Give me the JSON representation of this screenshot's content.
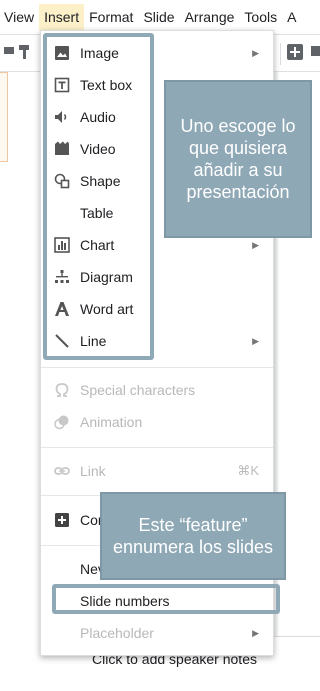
{
  "menubar": {
    "items": [
      "View",
      "Insert",
      "Format",
      "Slide",
      "Arrange",
      "Tools",
      "A"
    ],
    "active": "Insert"
  },
  "insert_menu": {
    "items": [
      {
        "label": "Image",
        "icon": "image-icon",
        "submenu": true
      },
      {
        "label": "Text box",
        "icon": "text-box-icon"
      },
      {
        "label": "Audio",
        "icon": "audio-icon"
      },
      {
        "label": "Video",
        "icon": "video-icon"
      },
      {
        "label": "Shape",
        "icon": "shape-icon",
        "submenu": true
      },
      {
        "label": "Table",
        "icon": "table-icon",
        "submenu": true
      },
      {
        "label": "Chart",
        "icon": "chart-icon",
        "submenu": true
      },
      {
        "label": "Diagram",
        "icon": "diagram-icon"
      },
      {
        "label": "Word art",
        "icon": "word-art-icon"
      },
      {
        "label": "Line",
        "icon": "line-icon",
        "submenu": true
      },
      {
        "label": "Special characters",
        "icon": "omega-icon",
        "disabled": true
      },
      {
        "label": "Animation",
        "icon": "animation-icon",
        "disabled": true
      },
      {
        "label": "Link",
        "icon": "link-icon",
        "disabled": true,
        "shortcut": "⌘K"
      },
      {
        "label": "Cor",
        "icon": "comment-plus-icon"
      },
      {
        "label": "Nev"
      },
      {
        "label": "Slide numbers"
      },
      {
        "label": "Placeholder",
        "disabled": true,
        "submenu": true
      }
    ]
  },
  "annotations": {
    "menu_callout": "Uno escoge lo que quisiera añadir a su presentación",
    "slide_numbers_callout": "Este “feature” ennumera los slides"
  },
  "notes": {
    "placeholder": "Click to add speaker notes"
  },
  "colors": {
    "annotation": "#8fa8b6",
    "active_menu": "#fcf0c9"
  }
}
